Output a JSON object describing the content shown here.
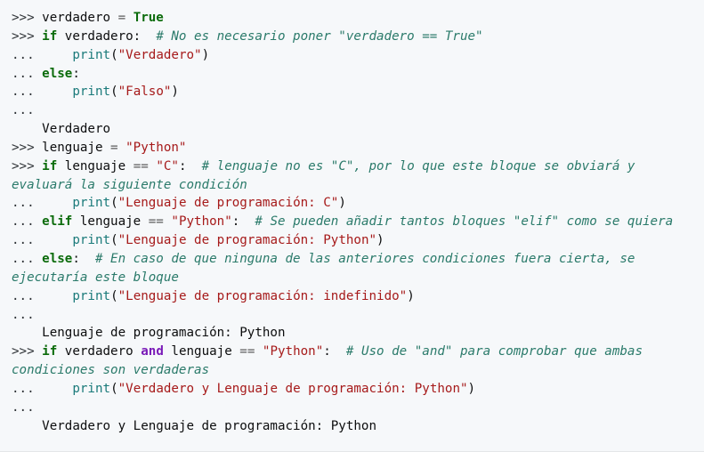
{
  "colors": {
    "background": "#f6f8fa",
    "keyword": "#0b6b0b",
    "keyword_logical": "#7a1bb8",
    "string": "#a61a1a",
    "builtin": "#1a7a7a",
    "comment": "#2a7a6a",
    "text": "#0c0d0e"
  },
  "lines": [
    [
      {
        "t": "p",
        "v": ">>> "
      },
      {
        "t": "n",
        "v": "verdadero "
      },
      {
        "t": "o",
        "v": "="
      },
      {
        "t": "n",
        "v": " "
      },
      {
        "t": "k",
        "v": "True"
      }
    ],
    [
      {
        "t": "p",
        "v": ">>> "
      },
      {
        "t": "k",
        "v": "if"
      },
      {
        "t": "n",
        "v": " verdadero:  "
      },
      {
        "t": "c",
        "v": "# No es necesario poner \"verdadero == True\""
      }
    ],
    [
      {
        "t": "p",
        "v": "...     "
      },
      {
        "t": "f",
        "v": "print"
      },
      {
        "t": "n",
        "v": "("
      },
      {
        "t": "s",
        "v": "\"Verdadero\""
      },
      {
        "t": "n",
        "v": ")"
      }
    ],
    [
      {
        "t": "p",
        "v": "... "
      },
      {
        "t": "k",
        "v": "else"
      },
      {
        "t": "n",
        "v": ":"
      }
    ],
    [
      {
        "t": "p",
        "v": "...     "
      },
      {
        "t": "f",
        "v": "print"
      },
      {
        "t": "n",
        "v": "("
      },
      {
        "t": "s",
        "v": "\"Falso\""
      },
      {
        "t": "n",
        "v": ")"
      }
    ],
    [
      {
        "t": "p",
        "v": "..."
      }
    ],
    [
      {
        "t": "r",
        "v": "    Verdadero"
      }
    ],
    [
      {
        "t": "p",
        "v": ">>> "
      },
      {
        "t": "n",
        "v": "lenguaje "
      },
      {
        "t": "o",
        "v": "="
      },
      {
        "t": "n",
        "v": " "
      },
      {
        "t": "s",
        "v": "\"Python\""
      }
    ],
    [
      {
        "t": "p",
        "v": ">>> "
      },
      {
        "t": "k",
        "v": "if"
      },
      {
        "t": "n",
        "v": " lenguaje "
      },
      {
        "t": "o",
        "v": "=="
      },
      {
        "t": "n",
        "v": " "
      },
      {
        "t": "s",
        "v": "\"C\""
      },
      {
        "t": "n",
        "v": ":  "
      },
      {
        "t": "c",
        "v": "# lenguaje no es \"C\", por lo que este bloque se obviará y evaluará la siguiente condición"
      }
    ],
    [
      {
        "t": "p",
        "v": "...     "
      },
      {
        "t": "f",
        "v": "print"
      },
      {
        "t": "n",
        "v": "("
      },
      {
        "t": "s",
        "v": "\"Lenguaje de programación: C\""
      },
      {
        "t": "n",
        "v": ")"
      }
    ],
    [
      {
        "t": "p",
        "v": "... "
      },
      {
        "t": "k",
        "v": "elif"
      },
      {
        "t": "n",
        "v": " lenguaje "
      },
      {
        "t": "o",
        "v": "=="
      },
      {
        "t": "n",
        "v": " "
      },
      {
        "t": "s",
        "v": "\"Python\""
      },
      {
        "t": "n",
        "v": ":  "
      },
      {
        "t": "c",
        "v": "# Se pueden añadir tantos bloques \"elif\" como se quiera"
      }
    ],
    [
      {
        "t": "p",
        "v": "...     "
      },
      {
        "t": "f",
        "v": "print"
      },
      {
        "t": "n",
        "v": "("
      },
      {
        "t": "s",
        "v": "\"Lenguaje de programación: Python\""
      },
      {
        "t": "n",
        "v": ")"
      }
    ],
    [
      {
        "t": "p",
        "v": "... "
      },
      {
        "t": "k",
        "v": "else"
      },
      {
        "t": "n",
        "v": ":  "
      },
      {
        "t": "c",
        "v": "# En caso de que ninguna de las anteriores condiciones fuera cierta, se ejecutaría este bloque"
      }
    ],
    [
      {
        "t": "p",
        "v": "...     "
      },
      {
        "t": "f",
        "v": "print"
      },
      {
        "t": "n",
        "v": "("
      },
      {
        "t": "s",
        "v": "\"Lenguaje de programación: indefinido\""
      },
      {
        "t": "n",
        "v": ")"
      }
    ],
    [
      {
        "t": "p",
        "v": "..."
      }
    ],
    [
      {
        "t": "r",
        "v": "    Lenguaje de programación: Python"
      }
    ],
    [
      {
        "t": "p",
        "v": ">>> "
      },
      {
        "t": "k",
        "v": "if"
      },
      {
        "t": "n",
        "v": " verdadero "
      },
      {
        "t": "a",
        "v": "and"
      },
      {
        "t": "n",
        "v": " lenguaje "
      },
      {
        "t": "o",
        "v": "=="
      },
      {
        "t": "n",
        "v": " "
      },
      {
        "t": "s",
        "v": "\"Python\""
      },
      {
        "t": "n",
        "v": ":  "
      },
      {
        "t": "c",
        "v": "# Uso de \"and\" para comprobar que ambas condiciones son verdaderas"
      }
    ],
    [
      {
        "t": "p",
        "v": "...     "
      },
      {
        "t": "f",
        "v": "print"
      },
      {
        "t": "n",
        "v": "("
      },
      {
        "t": "s",
        "v": "\"Verdadero y Lenguaje de programación: Python\""
      },
      {
        "t": "n",
        "v": ")"
      }
    ],
    [
      {
        "t": "p",
        "v": "..."
      }
    ],
    [
      {
        "t": "r",
        "v": "    Verdadero y Lenguaje de programación: Python"
      }
    ]
  ]
}
